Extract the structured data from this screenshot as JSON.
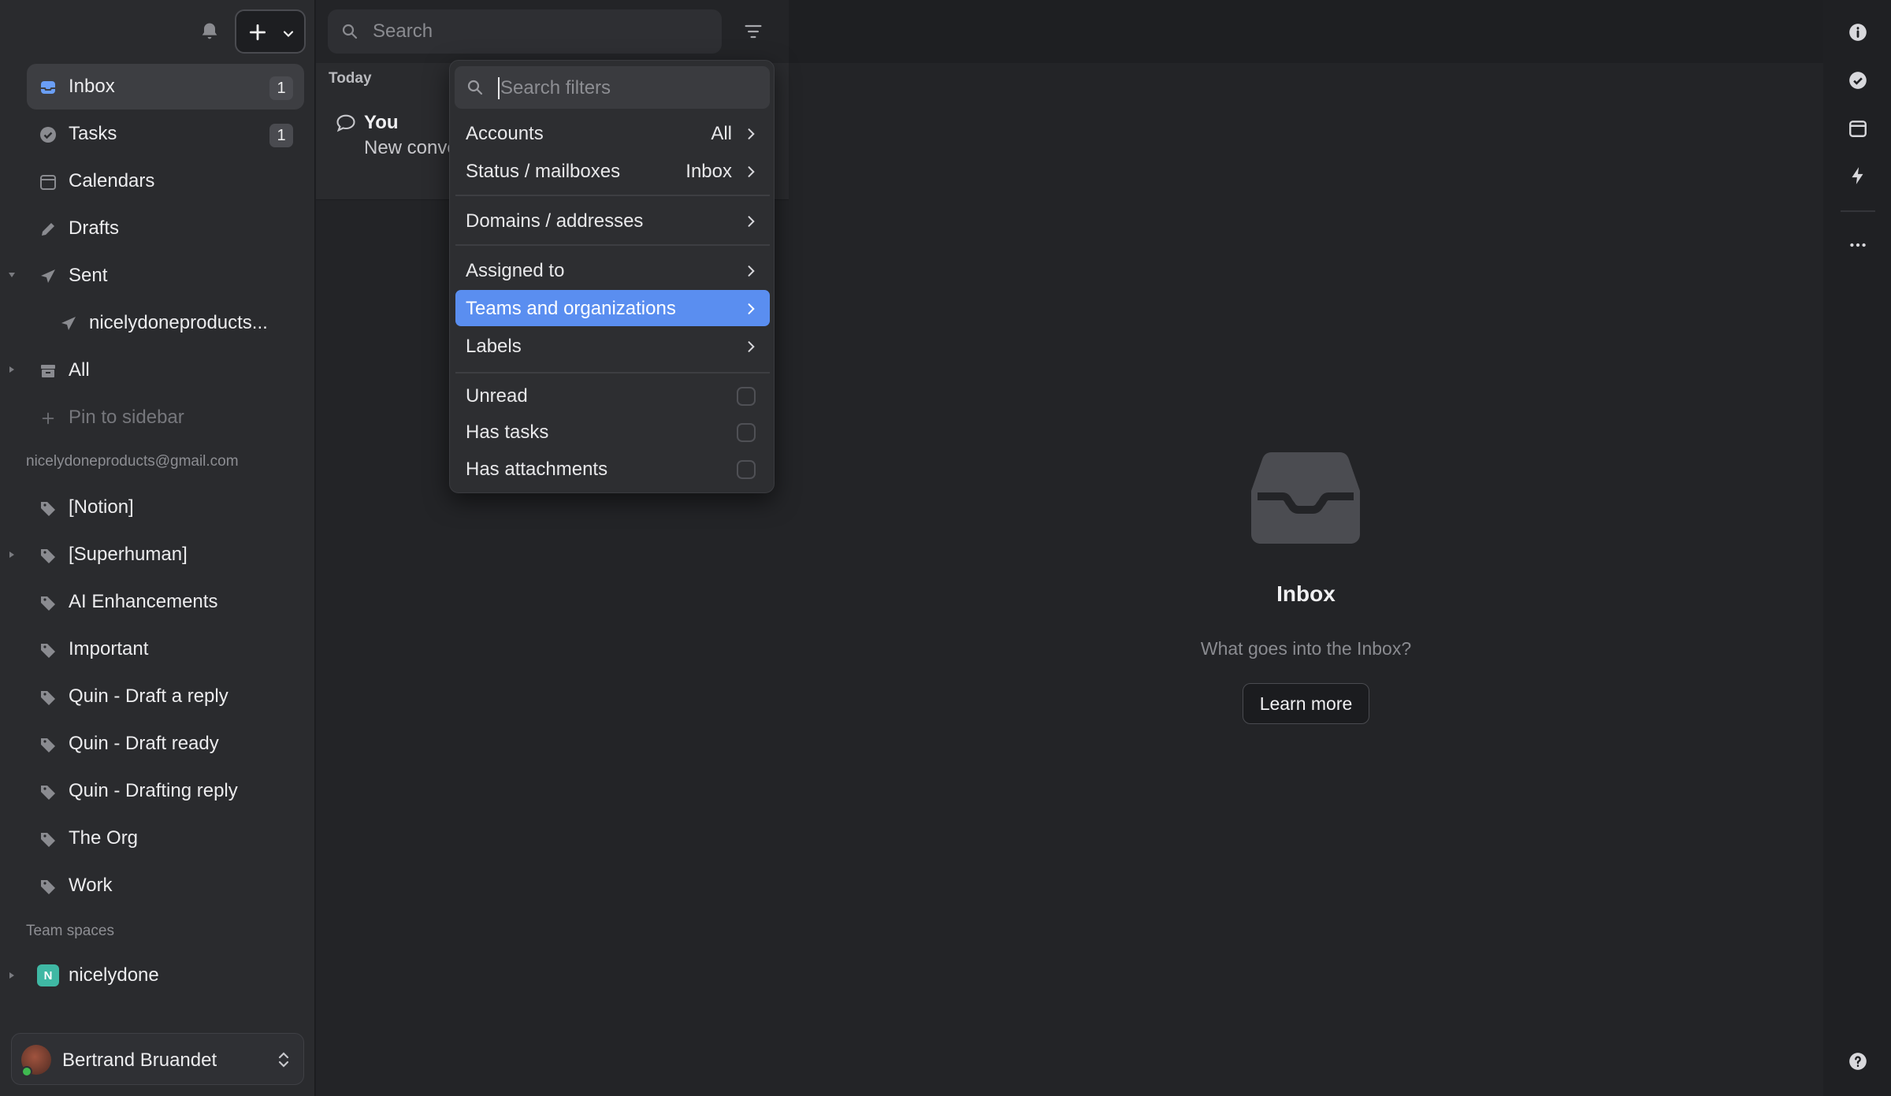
{
  "sidebar": {
    "items": [
      {
        "label": "Inbox",
        "count": "1",
        "icon": "inbox-icon"
      },
      {
        "label": "Tasks",
        "count": "1",
        "icon": "check-circle-icon"
      },
      {
        "label": "Calendars",
        "icon": "calendar-icon"
      },
      {
        "label": "Drafts",
        "icon": "pencil-icon"
      },
      {
        "label": "Sent",
        "icon": "send-icon"
      },
      {
        "label": "nicelydoneproducts...",
        "icon": "send-icon"
      },
      {
        "label": "All",
        "icon": "archive-icon"
      },
      {
        "label": "Pin to sidebar",
        "icon": "plus-icon"
      }
    ],
    "account_email": "nicelydoneproducts@gmail.com",
    "labels": [
      "[Notion]",
      "[Superhuman]",
      "AI Enhancements",
      "Important",
      "Quin - Draft a reply",
      "Quin - Draft ready",
      "Quin - Drafting reply",
      "The Org",
      "Work"
    ],
    "team_spaces_title": "Team spaces",
    "team": {
      "badge": "N",
      "name": "nicelydone"
    },
    "user": {
      "name": "Bertrand Bruandet"
    }
  },
  "search": {
    "placeholder": "Search"
  },
  "list": {
    "group": "Today",
    "item": {
      "sender": "You",
      "preview": "New conve"
    }
  },
  "filter_menu": {
    "search_placeholder": "Search filters",
    "rows": [
      {
        "label": "Accounts",
        "value": "All"
      },
      {
        "label": "Status / mailboxes",
        "value": "Inbox"
      },
      {
        "label": "Domains / addresses",
        "value": ""
      },
      {
        "label": "Assigned to",
        "value": ""
      },
      {
        "label": "Teams and organizations",
        "value": ""
      },
      {
        "label": "Labels",
        "value": ""
      }
    ],
    "checks": [
      "Unread",
      "Has tasks",
      "Has attachments"
    ]
  },
  "empty_state": {
    "title": "Inbox",
    "subtitle": "What goes into the Inbox?",
    "button": "Learn more"
  },
  "colors": {
    "accent": "#5a8ef0",
    "online": "#3fb950",
    "team_badge": "#3fb8a4"
  }
}
